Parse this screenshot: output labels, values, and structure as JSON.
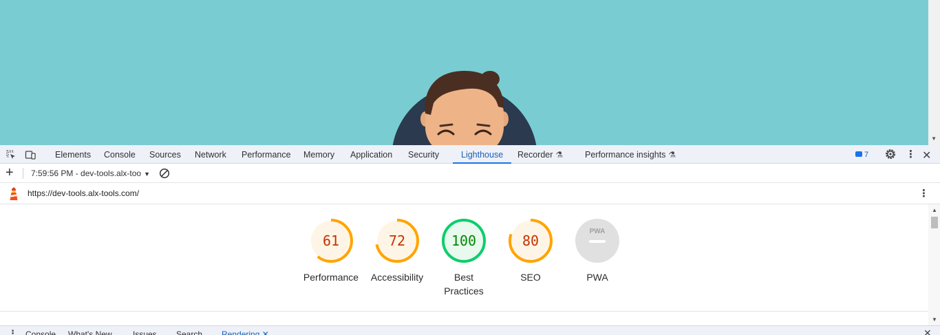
{
  "devtools": {
    "tabs": [
      {
        "label": "Elements"
      },
      {
        "label": "Console"
      },
      {
        "label": "Sources"
      },
      {
        "label": "Network"
      },
      {
        "label": "Performance"
      },
      {
        "label": "Memory"
      },
      {
        "label": "Application"
      },
      {
        "label": "Security"
      },
      {
        "label": "Lighthouse",
        "active": true
      },
      {
        "label": "Recorder",
        "experimental": true
      },
      {
        "label": "Performance insights",
        "experimental": true
      }
    ],
    "issues_count": "7",
    "accent_color": "#1a73e8"
  },
  "lighthouse": {
    "report_selector": "7:59:56 PM - dev-tools.alx-too",
    "url": "https://dev-tools.alx-tools.com/",
    "scores": [
      {
        "value": "61",
        "label": "Performance",
        "fraction": 0.61,
        "status": "average"
      },
      {
        "value": "72",
        "label": "Accessibility",
        "fraction": 0.72,
        "status": "average"
      },
      {
        "value": "100",
        "label": "Best Practices",
        "fraction": 1.0,
        "status": "pass"
      },
      {
        "value": "80",
        "label": "SEO",
        "fraction": 0.8,
        "status": "average"
      },
      {
        "value": "PWA",
        "label": "PWA",
        "status": "not-applicable"
      }
    ],
    "colors": {
      "average": "#ffa400",
      "average_text": "#c33300",
      "pass": "#0cce6b",
      "pass_text": "#008800",
      "na": "#e0e0e0"
    }
  },
  "drawer": {
    "tabs": [
      {
        "label": "Console"
      },
      {
        "label": "What's New"
      },
      {
        "label": "Issues"
      },
      {
        "label": "Search"
      },
      {
        "label": "Rendering",
        "active": true
      }
    ]
  }
}
